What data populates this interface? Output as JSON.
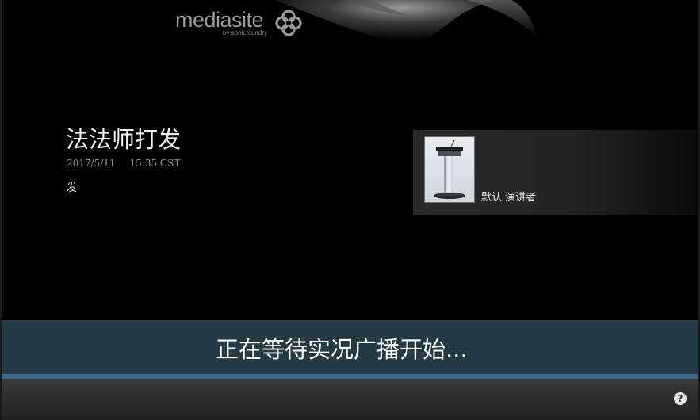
{
  "branding": {
    "logo_text": "mediasite",
    "logo_subtext": "by sonicfoundry"
  },
  "presentation": {
    "title": "法法师打发",
    "date": "2017/5/11",
    "time": "15:35 CST",
    "description": "发"
  },
  "presenter": {
    "name": "默认 演讲者"
  },
  "status": {
    "message": "正在等待实况广播开始..."
  },
  "controls": {
    "help_label": "?"
  },
  "colors": {
    "background": "#000000",
    "banner": "#243a45",
    "banner_stripe": "#3e6a91",
    "control_bar": "#2b2b2b",
    "logo_gray": "#9a9a9a"
  },
  "icons": {
    "logo_mark": "mediasite-flower-icon",
    "presenter_avatar": "podium-icon",
    "help": "help-icon"
  }
}
